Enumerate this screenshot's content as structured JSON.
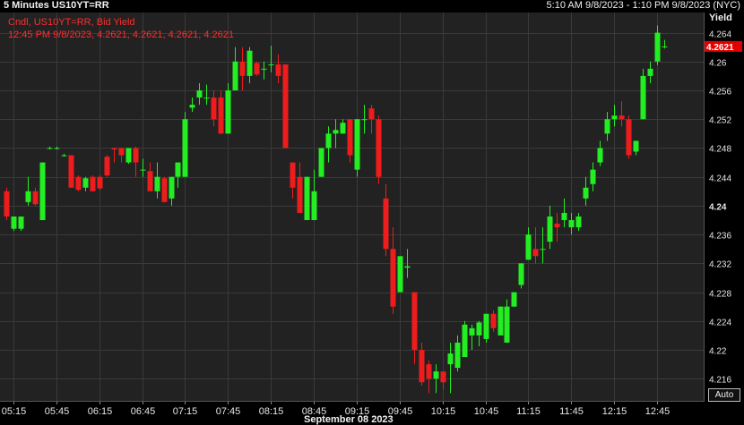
{
  "header": {
    "title": "5 Minutes US10YT=RR",
    "time_range": "5:10 AM 9/8/2023 - 1:10 PM 9/8/2023 (NYC)"
  },
  "legend": {
    "line1": "Cndl, US10YT=RR, Bid Yield",
    "line2": "12:45 PM 9/8/2023, 4.2621, 4.2621, 4.2621, 4.2621"
  },
  "controls": {
    "auto_label": "Auto"
  },
  "colors": {
    "up": "#22ee22",
    "down": "#ee1c1c",
    "grid": "#3a3a3a",
    "background": "#222222",
    "last_price_bg": "#e10000"
  },
  "chart_data": {
    "type": "candlestick",
    "ylabel": "Yield",
    "xlabel": "September 08 2023",
    "ylim": [
      4.2128,
      4.2668
    ],
    "yticks": [
      4.216,
      4.22,
      4.224,
      4.228,
      4.232,
      4.236,
      4.24,
      4.244,
      4.248,
      4.252,
      4.256,
      4.26,
      4.264
    ],
    "ytick_labels": [
      "4.216",
      "4.22",
      "4.224",
      "4.228",
      "4.232",
      "4.236",
      "4.24",
      "4.244",
      "4.248",
      "4.252",
      "4.256",
      "4.26",
      "4.264"
    ],
    "bold_tick": "4.24",
    "last_value_label": "4.2621",
    "last_value": 4.2621,
    "x_start": "05:10",
    "x_end": "12:50",
    "x_ticks": [
      "05:15",
      "05:45",
      "06:15",
      "06:45",
      "07:15",
      "07:45",
      "08:15",
      "08:45",
      "09:15",
      "09:45",
      "10:15",
      "10:45",
      "11:15",
      "11:45",
      "12:15",
      "12:45"
    ],
    "candles": [
      {
        "t": "05:10",
        "o": 4.242,
        "h": 4.2425,
        "l": 4.238,
        "c": 4.2385
      },
      {
        "t": "05:15",
        "o": 4.2368,
        "h": 4.2385,
        "l": 4.2365,
        "c": 4.2385
      },
      {
        "t": "05:20",
        "o": 4.2368,
        "h": 4.2385,
        "l": 4.2365,
        "c": 4.2385
      },
      {
        "t": "05:25",
        "o": 4.2405,
        "h": 4.244,
        "l": 4.24,
        "c": 4.242
      },
      {
        "t": "05:30",
        "o": 4.242,
        "h": 4.2425,
        "l": 4.24,
        "c": 4.2402
      },
      {
        "t": "05:35",
        "o": 4.238,
        "h": 4.246,
        "l": 4.238,
        "c": 4.246
      },
      {
        "t": "05:40",
        "o": 4.248,
        "h": 4.2482,
        "l": 4.2478,
        "c": 4.248
      },
      {
        "t": "05:45",
        "o": 4.248,
        "h": 4.2482,
        "l": 4.2478,
        "c": 4.248
      },
      {
        "t": "05:50",
        "o": 4.247,
        "h": 4.2472,
        "l": 4.2468,
        "c": 4.247
      },
      {
        "t": "05:55",
        "o": 4.247,
        "h": 4.247,
        "l": 4.2425,
        "c": 4.2425
      },
      {
        "t": "06:00",
        "o": 4.244,
        "h": 4.2442,
        "l": 4.242,
        "c": 4.2422
      },
      {
        "t": "06:05",
        "o": 4.2425,
        "h": 4.244,
        "l": 4.242,
        "c": 4.2438
      },
      {
        "t": "06:10",
        "o": 4.244,
        "h": 4.2442,
        "l": 4.242,
        "c": 4.242
      },
      {
        "t": "06:15",
        "o": 4.244,
        "h": 4.2442,
        "l": 4.2422,
        "c": 4.2424
      },
      {
        "t": "06:20",
        "o": 4.2468,
        "h": 4.247,
        "l": 4.244,
        "c": 4.2442
      },
      {
        "t": "06:25",
        "o": 4.248,
        "h": 4.248,
        "l": 4.246,
        "c": 4.2478
      },
      {
        "t": "06:30",
        "o": 4.248,
        "h": 4.248,
        "l": 4.246,
        "c": 4.247
      },
      {
        "t": "06:35",
        "o": 4.246,
        "h": 4.248,
        "l": 4.2458,
        "c": 4.248
      },
      {
        "t": "06:40",
        "o": 4.248,
        "h": 4.2482,
        "l": 4.244,
        "c": 4.246
      },
      {
        "t": "06:45",
        "o": 4.245,
        "h": 4.2465,
        "l": 4.244,
        "c": 4.245
      },
      {
        "t": "06:50",
        "o": 4.2448,
        "h": 4.246,
        "l": 4.242,
        "c": 4.242
      },
      {
        "t": "06:55",
        "o": 4.242,
        "h": 4.246,
        "l": 4.241,
        "c": 4.244
      },
      {
        "t": "07:00",
        "o": 4.2438,
        "h": 4.244,
        "l": 4.2405,
        "c": 4.2405
      },
      {
        "t": "07:05",
        "o": 4.241,
        "h": 4.244,
        "l": 4.24,
        "c": 4.244
      },
      {
        "t": "07:10",
        "o": 4.244,
        "h": 4.246,
        "l": 4.2425,
        "c": 4.246
      },
      {
        "t": "07:15",
        "o": 4.244,
        "h": 4.253,
        "l": 4.244,
        "c": 4.252
      },
      {
        "t": "07:20",
        "o": 4.2536,
        "h": 4.255,
        "l": 4.253,
        "c": 4.254
      },
      {
        "t": "07:25",
        "o": 4.255,
        "h": 4.257,
        "l": 4.254,
        "c": 4.256
      },
      {
        "t": "07:30",
        "o": 4.255,
        "h": 4.2568,
        "l": 4.254,
        "c": 4.255
      },
      {
        "t": "07:35",
        "o": 4.255,
        "h": 4.256,
        "l": 4.251,
        "c": 4.252
      },
      {
        "t": "07:40",
        "o": 4.255,
        "h": 4.256,
        "l": 4.25,
        "c": 4.25
      },
      {
        "t": "07:45",
        "o": 4.25,
        "h": 4.257,
        "l": 4.25,
        "c": 4.256
      },
      {
        "t": "07:50",
        "o": 4.256,
        "h": 4.262,
        "l": 4.256,
        "c": 4.26
      },
      {
        "t": "07:55",
        "o": 4.26,
        "h": 4.262,
        "l": 4.256,
        "c": 4.258
      },
      {
        "t": "08:00",
        "o": 4.258,
        "h": 4.262,
        "l": 4.257,
        "c": 4.2615
      },
      {
        "t": "08:05",
        "o": 4.2598,
        "h": 4.26,
        "l": 4.258,
        "c": 4.2582
      },
      {
        "t": "08:10",
        "o": 4.259,
        "h": 4.26,
        "l": 4.2575,
        "c": 4.259
      },
      {
        "t": "08:15",
        "o": 4.2595,
        "h": 4.2622,
        "l": 4.2585,
        "c": 4.2596
      },
      {
        "t": "08:20",
        "o": 4.2596,
        "h": 4.261,
        "l": 4.257,
        "c": 4.258
      },
      {
        "t": "08:25",
        "o": 4.2596,
        "h": 4.2596,
        "l": 4.248,
        "c": 4.248
      },
      {
        "t": "08:30",
        "o": 4.246,
        "h": 4.246,
        "l": 4.241,
        "c": 4.2425
      },
      {
        "t": "08:35",
        "o": 4.244,
        "h": 4.246,
        "l": 4.239,
        "c": 4.239
      },
      {
        "t": "08:40",
        "o": 4.238,
        "h": 4.244,
        "l": 4.238,
        "c": 4.244
      },
      {
        "t": "08:45",
        "o": 4.238,
        "h": 4.245,
        "l": 4.238,
        "c": 4.242
      },
      {
        "t": "08:50",
        "o": 4.244,
        "h": 4.248,
        "l": 4.244,
        "c": 4.248
      },
      {
        "t": "08:55",
        "o": 4.248,
        "h": 4.251,
        "l": 4.246,
        "c": 4.25
      },
      {
        "t": "09:00",
        "o": 4.25,
        "h": 4.252,
        "l": 4.248,
        "c": 4.2505
      },
      {
        "t": "09:05",
        "o": 4.25,
        "h": 4.252,
        "l": 4.25,
        "c": 4.2515
      },
      {
        "t": "09:10",
        "o": 4.252,
        "h": 4.252,
        "l": 4.246,
        "c": 4.247
      },
      {
        "t": "09:15",
        "o": 4.245,
        "h": 4.252,
        "l": 4.244,
        "c": 4.252
      },
      {
        "t": "09:20",
        "o": 4.252,
        "h": 4.254,
        "l": 4.25,
        "c": 4.252
      },
      {
        "t": "09:25",
        "o": 4.2535,
        "h": 4.254,
        "l": 4.25,
        "c": 4.252
      },
      {
        "t": "09:30",
        "o": 4.252,
        "h": 4.2525,
        "l": 4.243,
        "c": 4.244
      },
      {
        "t": "09:35",
        "o": 4.241,
        "h": 4.243,
        "l": 4.233,
        "c": 4.234
      },
      {
        "t": "09:40",
        "o": 4.234,
        "h": 4.237,
        "l": 4.225,
        "c": 4.226
      },
      {
        "t": "09:45",
        "o": 4.228,
        "h": 4.233,
        "l": 4.228,
        "c": 4.233
      },
      {
        "t": "09:50",
        "o": 4.2314,
        "h": 4.234,
        "l": 4.23,
        "c": 4.2316
      },
      {
        "t": "09:55",
        "o": 4.228,
        "h": 4.228,
        "l": 4.218,
        "c": 4.22
      },
      {
        "t": "10:00",
        "o": 4.22,
        "h": 4.221,
        "l": 4.215,
        "c": 4.2155
      },
      {
        "t": "10:05",
        "o": 4.218,
        "h": 4.2185,
        "l": 4.214,
        "c": 4.216
      },
      {
        "t": "10:10",
        "o": 4.216,
        "h": 4.218,
        "l": 4.214,
        "c": 4.217
      },
      {
        "t": "10:15",
        "o": 4.217,
        "h": 4.217,
        "l": 4.2145,
        "c": 4.2155
      },
      {
        "t": "10:20",
        "o": 4.218,
        "h": 4.221,
        "l": 4.214,
        "c": 4.2195
      },
      {
        "t": "10:25",
        "o": 4.2175,
        "h": 4.222,
        "l": 4.217,
        "c": 4.221
      },
      {
        "t": "10:30",
        "o": 4.219,
        "h": 4.224,
        "l": 4.219,
        "c": 4.2235
      },
      {
        "t": "10:35",
        "o": 4.222,
        "h": 4.2235,
        "l": 4.22,
        "c": 4.223
      },
      {
        "t": "10:40",
        "o": 4.222,
        "h": 4.224,
        "l": 4.2205,
        "c": 4.2238
      },
      {
        "t": "10:45",
        "o": 4.2215,
        "h": 4.224,
        "l": 4.221,
        "c": 4.225
      },
      {
        "t": "10:50",
        "o": 4.225,
        "h": 4.2255,
        "l": 4.2225,
        "c": 4.223
      },
      {
        "t": "10:55",
        "o": 4.222,
        "h": 4.226,
        "l": 4.222,
        "c": 4.226
      },
      {
        "t": "11:00",
        "o": 4.221,
        "h": 4.227,
        "l": 4.221,
        "c": 4.226
      },
      {
        "t": "11:05",
        "o": 4.226,
        "h": 4.228,
        "l": 4.226,
        "c": 4.228
      },
      {
        "t": "11:10",
        "o": 4.229,
        "h": 4.232,
        "l": 4.2285,
        "c": 4.232
      },
      {
        "t": "11:15",
        "o": 4.2325,
        "h": 4.237,
        "l": 4.2325,
        "c": 4.236
      },
      {
        "t": "11:20",
        "o": 4.234,
        "h": 4.237,
        "l": 4.232,
        "c": 4.233
      },
      {
        "t": "11:25",
        "o": 4.234,
        "h": 4.237,
        "l": 4.232,
        "c": 4.234
      },
      {
        "t": "11:30",
        "o": 4.235,
        "h": 4.24,
        "l": 4.234,
        "c": 4.2385
      },
      {
        "t": "11:35",
        "o": 4.2375,
        "h": 4.239,
        "l": 4.235,
        "c": 4.237
      },
      {
        "t": "11:40",
        "o": 4.238,
        "h": 4.241,
        "l": 4.237,
        "c": 4.239
      },
      {
        "t": "11:45",
        "o": 4.237,
        "h": 4.239,
        "l": 4.236,
        "c": 4.238
      },
      {
        "t": "11:50",
        "o": 4.237,
        "h": 4.239,
        "l": 4.2365,
        "c": 4.2385
      },
      {
        "t": "11:55",
        "o": 4.241,
        "h": 4.244,
        "l": 4.24,
        "c": 4.2425
      },
      {
        "t": "12:00",
        "o": 4.243,
        "h": 4.246,
        "l": 4.242,
        "c": 4.245
      },
      {
        "t": "12:05",
        "o": 4.246,
        "h": 4.249,
        "l": 4.2455,
        "c": 4.248
      },
      {
        "t": "12:10",
        "o": 4.25,
        "h": 4.253,
        "l": 4.249,
        "c": 4.252
      },
      {
        "t": "12:15",
        "o": 4.252,
        "h": 4.254,
        "l": 4.251,
        "c": 4.2525
      },
      {
        "t": "12:20",
        "o": 4.2525,
        "h": 4.2545,
        "l": 4.251,
        "c": 4.252
      },
      {
        "t": "12:25",
        "o": 4.252,
        "h": 4.2525,
        "l": 4.2465,
        "c": 4.247
      },
      {
        "t": "12:30",
        "o": 4.2475,
        "h": 4.249,
        "l": 4.247,
        "c": 4.249
      },
      {
        "t": "12:35",
        "o": 4.252,
        "h": 4.259,
        "l": 4.252,
        "c": 4.258
      },
      {
        "t": "12:40",
        "o": 4.258,
        "h": 4.26,
        "l": 4.257,
        "c": 4.259
      },
      {
        "t": "12:45",
        "o": 4.26,
        "h": 4.265,
        "l": 4.2595,
        "c": 4.264
      },
      {
        "t": "12:50",
        "o": 4.2621,
        "h": 4.263,
        "l": 4.2618,
        "c": 4.2621
      }
    ]
  }
}
